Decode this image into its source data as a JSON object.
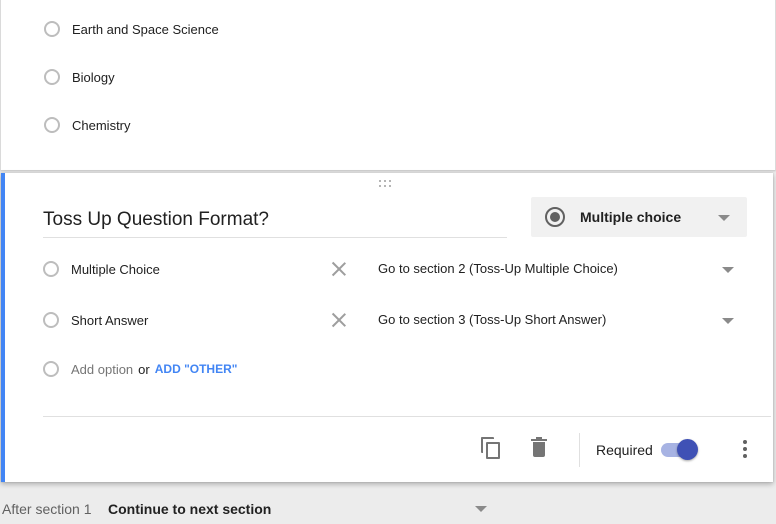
{
  "previous_question": {
    "options": [
      {
        "label": "Earth and Space Science"
      },
      {
        "label": "Biology"
      },
      {
        "label": "Chemistry"
      }
    ]
  },
  "active_question": {
    "title": "Toss Up Question Format?",
    "type_selector": {
      "label": "Multiple choice",
      "icon": "radio-checked-icon"
    },
    "choices": [
      {
        "label": "Multiple Choice",
        "goto": "Go to section 2 (Toss-Up Multiple Choice)"
      },
      {
        "label": "Short Answer",
        "goto": "Go to section 3 (Toss-Up Short Answer)"
      }
    ],
    "add_option": {
      "placeholder": "Add option",
      "or": "or",
      "add_other": "ADD \"OTHER\""
    },
    "footer": {
      "duplicate_icon": "copy-icon",
      "delete_icon": "trash-icon",
      "required_label": "Required",
      "required_on": true,
      "more_icon": "more-vert-icon"
    }
  },
  "after_section": {
    "label": "After section 1",
    "value": "Continue to next section"
  },
  "colors": {
    "accent": "#4285f4",
    "toggle_thumb": "#3f51b5",
    "toggle_track": "#a7b3e3"
  }
}
